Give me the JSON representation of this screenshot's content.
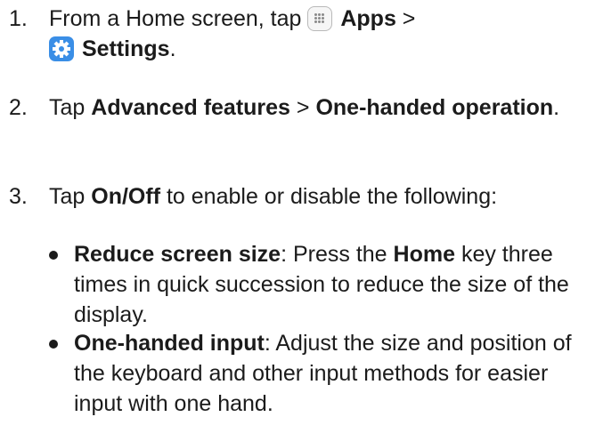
{
  "steps": [
    {
      "number": "1.",
      "segments": [
        {
          "text": "From a Home screen, tap "
        },
        {
          "icon": "apps-icon"
        },
        {
          "text": " "
        },
        {
          "text": "Apps",
          "bold": true
        },
        {
          "text": " > "
        },
        {
          "icon": "settings-icon"
        },
        {
          "text": " "
        },
        {
          "text": "Settings",
          "bold": true
        },
        {
          "text": "."
        }
      ]
    },
    {
      "number": "2.",
      "segments": [
        {
          "text": "Tap "
        },
        {
          "text": "Advanced features",
          "bold": true
        },
        {
          "text": " > "
        },
        {
          "text": "One-handed operation",
          "bold": true
        },
        {
          "text": "."
        }
      ]
    },
    {
      "number": "3.",
      "segments": [
        {
          "text": "Tap "
        },
        {
          "text": "On/Off",
          "bold": true
        },
        {
          "text": " to enable or disable the following:"
        }
      ]
    }
  ],
  "bullets": [
    {
      "segments": [
        {
          "text": "Reduce screen size",
          "bold": true
        },
        {
          "text": ": Press the "
        },
        {
          "text": "Home",
          "bold": true
        },
        {
          "text": " key three times in quick succession to reduce the size of the display."
        }
      ]
    },
    {
      "segments": [
        {
          "text": "One-handed input",
          "bold": true
        },
        {
          "text": ": Adjust the size and position of the keyboard and other input methods for easier input with one hand."
        }
      ]
    }
  ]
}
